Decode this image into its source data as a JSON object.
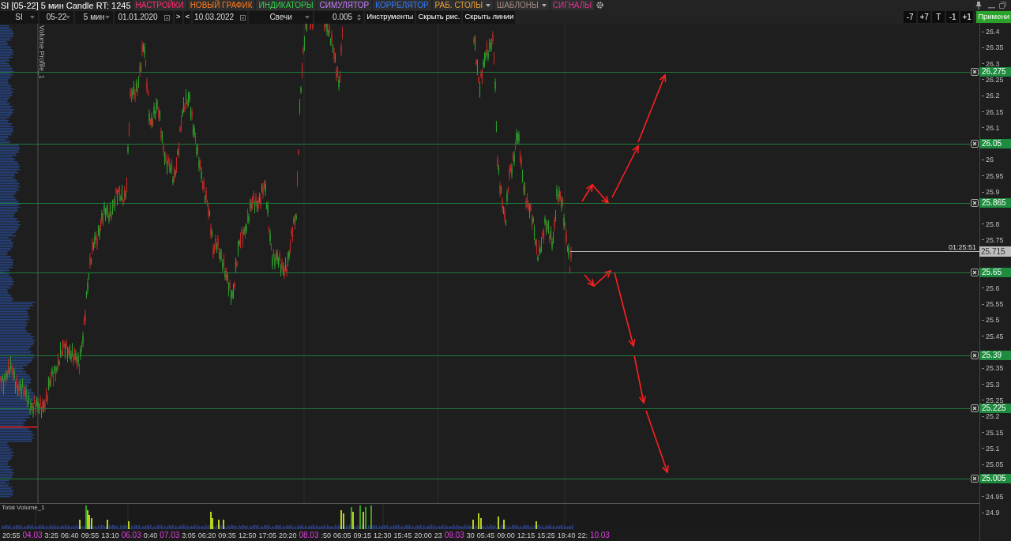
{
  "title_bar": {
    "title": "SI [05-22] 5 мин Candle RT: 1245",
    "menu": [
      {
        "label": "НАСТРОЙКИ",
        "color": "#ff2d6f",
        "dropdown": false
      },
      {
        "label": "НОВЫЙ ГРАФИК",
        "color": "#ff7a1a",
        "dropdown": false
      },
      {
        "label": "ИНДИКАТОРЫ",
        "color": "#2fd14a",
        "dropdown": false
      },
      {
        "label": "СИМУЛЯТОР",
        "color": "#c77dff",
        "dropdown": false
      },
      {
        "label": "КОРРЕЛЯТОР",
        "color": "#2f7bff",
        "dropdown": false
      },
      {
        "label": "РАБ. СТОЛЫ",
        "color": "#e8a13a",
        "dropdown": true
      },
      {
        "label": "ШАБЛОНЫ",
        "color": "#a08a80",
        "dropdown": true
      },
      {
        "label": "СИГНАЛЫ",
        "color": "#e0308f",
        "dropdown": false
      }
    ]
  },
  "toolbar": [
    {
      "kind": "select",
      "value": "SI"
    },
    {
      "kind": "select",
      "value": "05-22"
    },
    {
      "kind": "select",
      "value": "5 мин"
    },
    {
      "kind": "date",
      "value": "01.01.2020"
    },
    {
      "kind": "button",
      "label": ">"
    },
    {
      "kind": "button",
      "label": "<"
    },
    {
      "kind": "date",
      "value": "10.03.2022"
    },
    {
      "kind": "select",
      "value": "Свечи"
    },
    {
      "kind": "spinner",
      "value": "0.005"
    },
    {
      "kind": "button",
      "label": "Инструменты"
    },
    {
      "kind": "button",
      "label": "Скрыть рис."
    },
    {
      "kind": "button",
      "label": "Скрыть линии"
    }
  ],
  "step_buttons": [
    "-7",
    "+7",
    "T",
    "-1",
    "+1"
  ],
  "apply_button": "Примени",
  "chart": {
    "indicator_label": "Volume Profile_1",
    "price_ticks": [
      "26.4",
      "26.35",
      "26.3",
      "26.25",
      "26.2",
      "26.15",
      "26.1",
      "26",
      "25.95",
      "25.9",
      "25.8",
      "25.75",
      "25.6",
      "25.55",
      "25.5",
      "25.45",
      "25.35",
      "25.3",
      "25.25",
      "25.2",
      "25.15",
      "25.1",
      "25.05",
      "24.95",
      "24.9"
    ],
    "levels": [
      "26.275",
      "26.05",
      "25.865",
      "25.65",
      "25.39",
      "25.225",
      "25.005"
    ],
    "current_price": {
      "value": "25.715",
      "timer": "01:25:51"
    },
    "volume_pane": {
      "label": "Total Volume_1"
    },
    "time_axis": [
      {
        "text": "20:55",
        "date": false
      },
      {
        "text": "04.03",
        "date": true
      },
      {
        "text": "3:25",
        "date": false
      },
      {
        "text": "06:40",
        "date": false
      },
      {
        "text": "09:55",
        "date": false
      },
      {
        "text": "13:10",
        "date": false
      },
      {
        "text": "06.03",
        "date": true
      },
      {
        "text": "0:40",
        "date": false
      },
      {
        "text": "07.03",
        "date": true
      },
      {
        "text": "3:05",
        "date": false
      },
      {
        "text": "06:20",
        "date": false
      },
      {
        "text": "09:35",
        "date": false
      },
      {
        "text": "12:50",
        "date": false
      },
      {
        "text": "17:05",
        "date": false
      },
      {
        "text": "20:20",
        "date": false
      },
      {
        "text": "08.03",
        "date": true
      },
      {
        "text": ":50",
        "date": false
      },
      {
        "text": "06:05",
        "date": false
      },
      {
        "text": "09:15",
        "date": false
      },
      {
        "text": "12:30",
        "date": false
      },
      {
        "text": "15:45",
        "date": false
      },
      {
        "text": "20:00",
        "date": false
      },
      {
        "text": "23",
        "date": false
      },
      {
        "text": "09.03",
        "date": true
      },
      {
        "text": "30",
        "date": false
      },
      {
        "text": "05:45",
        "date": false
      },
      {
        "text": "09:00",
        "date": false
      },
      {
        "text": "12:15",
        "date": false
      },
      {
        "text": "15:25",
        "date": false
      },
      {
        "text": "19:40",
        "date": false
      },
      {
        "text": "22:",
        "date": false
      },
      {
        "text": "10.03",
        "date": true
      }
    ]
  }
}
